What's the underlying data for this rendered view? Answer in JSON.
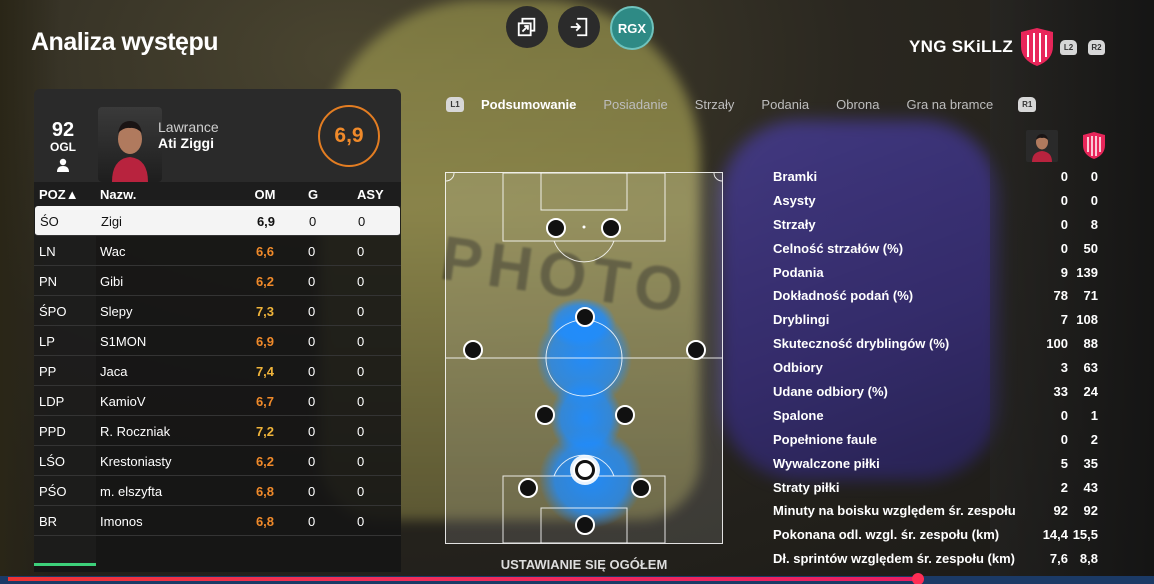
{
  "page": {
    "title": "Analiza występu"
  },
  "top_icons": [
    {
      "name": "switch-view-icon"
    },
    {
      "name": "exit-icon"
    },
    {
      "label": "RGX"
    }
  ],
  "team": {
    "name": "YNG SKiLLZ",
    "badge_colors": [
      "#e8265a",
      "#fff"
    ],
    "chips": [
      "L2",
      "R2"
    ]
  },
  "player": {
    "ovr": "92",
    "ovr_label": "OGL",
    "first_name": "Lawrance",
    "last_name": "Ati Ziggi",
    "rating": "6,9"
  },
  "table": {
    "headers": {
      "pos": "POZ▲",
      "name": "Nazw.",
      "om": "OM",
      "g": "G",
      "asy": "ASY"
    },
    "rows": [
      {
        "pos": "ŚO",
        "name": "Zigi",
        "om": "6,9",
        "g": "0",
        "asy": "0",
        "tone": "sel"
      },
      {
        "pos": "LN",
        "name": "Wac",
        "om": "6,6",
        "g": "0",
        "asy": "0",
        "tone": "orange"
      },
      {
        "pos": "PN",
        "name": "Gibi",
        "om": "6,2",
        "g": "0",
        "asy": "0",
        "tone": "orange"
      },
      {
        "pos": "ŚPO",
        "name": "Slepy",
        "om": "7,3",
        "g": "0",
        "asy": "0",
        "tone": "yellow"
      },
      {
        "pos": "LP",
        "name": "S1MON",
        "om": "6,9",
        "g": "0",
        "asy": "0",
        "tone": "orange"
      },
      {
        "pos": "PP",
        "name": "Jaca",
        "om": "7,4",
        "g": "0",
        "asy": "0",
        "tone": "yellow"
      },
      {
        "pos": "LDP",
        "name": "KamioV",
        "om": "6,7",
        "g": "0",
        "asy": "0",
        "tone": "orange"
      },
      {
        "pos": "PPD",
        "name": "R. Roczniak",
        "om": "7,2",
        "g": "0",
        "asy": "0",
        "tone": "yellow"
      },
      {
        "pos": "LŚO",
        "name": "Krestoniasty",
        "om": "6,2",
        "g": "0",
        "asy": "0",
        "tone": "orange"
      },
      {
        "pos": "PŚO",
        "name": "m. elszyfta",
        "om": "6,8",
        "g": "0",
        "asy": "0",
        "tone": "orange"
      },
      {
        "pos": "BR",
        "name": "Imonos",
        "om": "6,8",
        "g": "0",
        "asy": "0",
        "tone": "orange"
      }
    ]
  },
  "tabs": {
    "left_chip": "L1",
    "right_chip": "R1",
    "items": [
      "Podsumowanie",
      "Posiadanie",
      "Strzały",
      "Podania",
      "Obrona",
      "Gra na bramce"
    ],
    "active": "Podsumowanie"
  },
  "pitch": {
    "caption": "USTAWIANIE SIĘ OGÓŁEM"
  },
  "stats": [
    {
      "label": "Bramki",
      "player": "0",
      "team": "0"
    },
    {
      "label": "Asysty",
      "player": "0",
      "team": "0"
    },
    {
      "label": "Strzały",
      "player": "0",
      "team": "8"
    },
    {
      "label": "Celność strzałów (%)",
      "player": "0",
      "team": "50"
    },
    {
      "label": "Podania",
      "player": "9",
      "team": "139"
    },
    {
      "label": "Dokładność podań (%)",
      "player": "78",
      "team": "71"
    },
    {
      "label": "Dryblingi",
      "player": "7",
      "team": "108"
    },
    {
      "label": "Skuteczność dryblingów (%)",
      "player": "100",
      "team": "88"
    },
    {
      "label": "Odbiory",
      "player": "3",
      "team": "63"
    },
    {
      "label": "Udane odbiory (%)",
      "player": "33",
      "team": "24"
    },
    {
      "label": "Spalone",
      "player": "0",
      "team": "1"
    },
    {
      "label": "Popełnione faule",
      "player": "0",
      "team": "2"
    },
    {
      "label": "Wywalczone piłki",
      "player": "5",
      "team": "35"
    },
    {
      "label": "Straty piłki",
      "player": "2",
      "team": "43"
    },
    {
      "label": "Minuty na boisku względem śr. zespołu",
      "player": "92",
      "team": "92"
    },
    {
      "label": "Pokonana odl. wzgl. śr. zespołu (km)",
      "player": "14,4",
      "team": "15,5"
    },
    {
      "label": "Dł. sprintów względem śr. zespołu (km)",
      "player": "7,6",
      "team": "8,8"
    }
  ],
  "colors": {
    "accent": "#f08a2a",
    "rating_yellow": "#f0b43a",
    "heat": "#1e8cff",
    "rgx": "#2e8a85"
  }
}
